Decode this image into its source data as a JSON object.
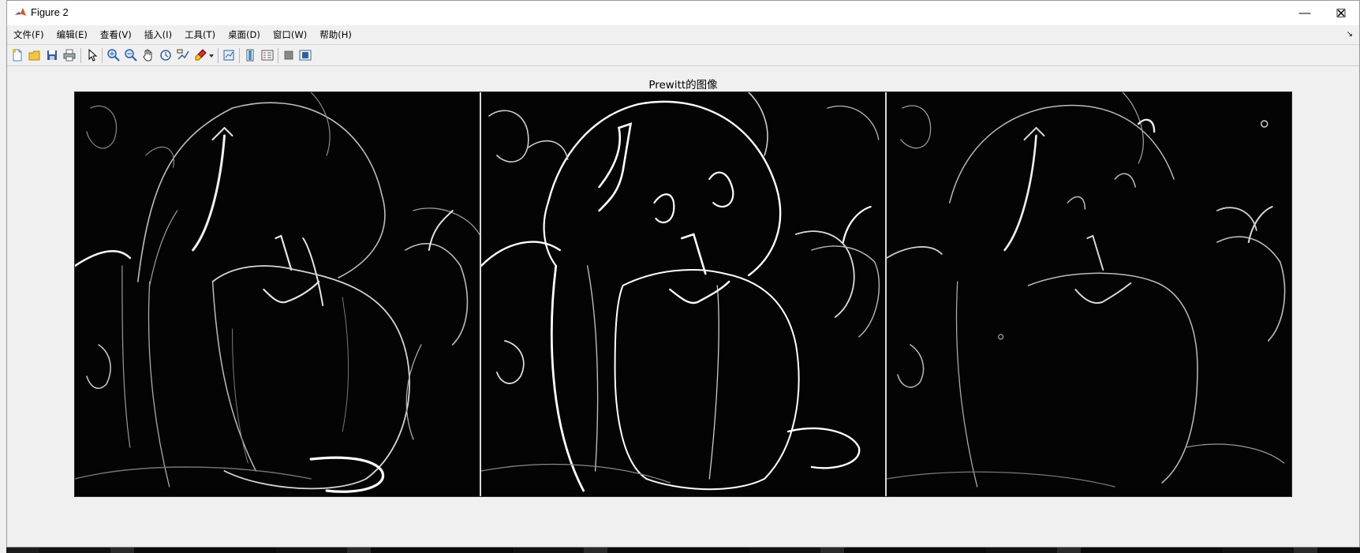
{
  "window": {
    "title": "Figure 2",
    "controls": {
      "minimize": "—",
      "maximize": "☐",
      "close": "✕"
    }
  },
  "menu": {
    "items": [
      "文件(F)",
      "编辑(E)",
      "查看(V)",
      "插入(I)",
      "工具(T)",
      "桌面(D)",
      "窗口(W)",
      "帮助(H)"
    ],
    "dock_glyph": "↘"
  },
  "toolbar": {
    "buttons": [
      "new-figure-icon",
      "open-file-icon",
      "save-icon",
      "print-icon",
      "select-arrow-icon",
      "zoom-in-icon",
      "zoom-out-icon",
      "pan-hand-icon",
      "rotate-3d-icon",
      "data-cursor-icon",
      "brush-icon",
      "dropdown-arrow-icon",
      "link-plot-icon",
      "insert-colorbar-icon",
      "insert-legend-icon",
      "hide-plot-tools-icon",
      "show-plot-tools-icon"
    ]
  },
  "figure": {
    "title": "Prewitt的图像",
    "panels": [
      "prewitt-edge-image-1",
      "prewitt-edge-image-2",
      "prewitt-edge-image-3"
    ]
  },
  "colors": {
    "window_bg": "#f0f0f0",
    "titlebar_bg": "#ffffff",
    "image_bg": "#000000",
    "edge_stroke": "#e8e8e8"
  }
}
